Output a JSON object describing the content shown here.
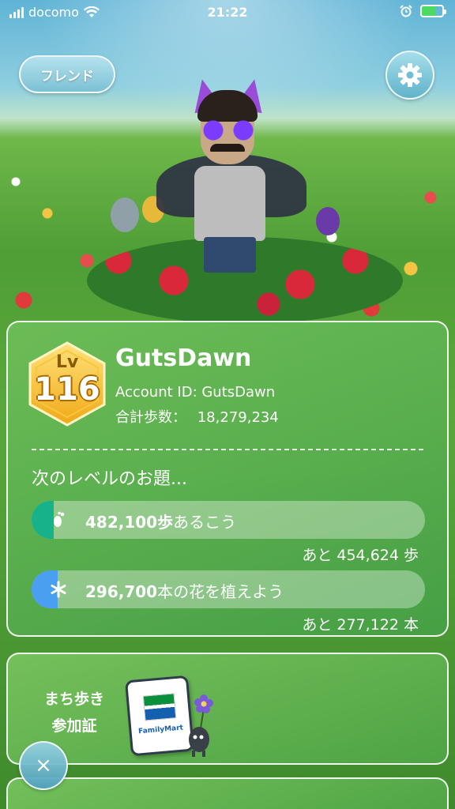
{
  "status_bar": {
    "carrier": "docomo",
    "time": "21:22",
    "battery_percent": 70
  },
  "header": {
    "friend_label": "フレンド",
    "settings_icon": "gear-icon"
  },
  "profile": {
    "level_label": "Lv",
    "level": "116",
    "username": "GutsDawn",
    "account_id_label": "Account ID: GutsDawn",
    "total_steps_label": "合計歩数：",
    "total_steps": "18,279,234"
  },
  "next_level": {
    "title": "次のレベルのお題...",
    "tasks": [
      {
        "icon": "footprint-icon",
        "value": "482,100歩",
        "text": "あるこう",
        "remaining_label": "あと 454,624 歩",
        "progress_fraction": 0.057,
        "color": "#17b28a"
      },
      {
        "icon": "flower-icon",
        "value": "296,700",
        "text": "本の花を植えよう",
        "remaining_label": "あと 277,122 本",
        "progress_fraction": 0.066,
        "color": "#4a9ff0"
      }
    ]
  },
  "walking_pass": {
    "label_line1": "まち歩き",
    "label_line2": "参加証",
    "card_brand": "FamilyMart"
  },
  "close_label": "×"
}
